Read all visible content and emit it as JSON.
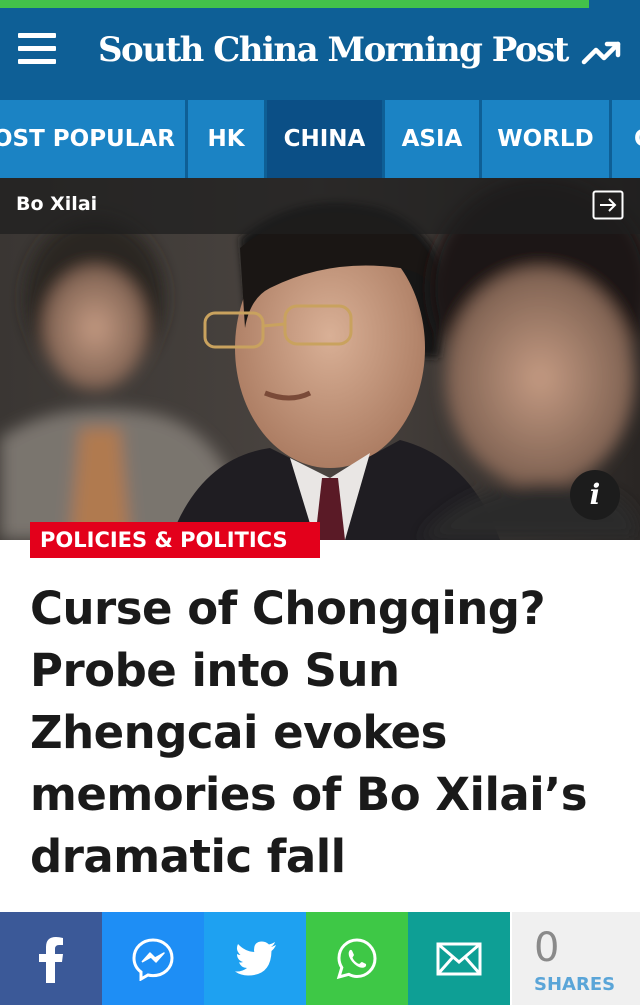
{
  "header": {
    "logo": "South China Morning Post",
    "read_progress": 0.92,
    "colors": {
      "header_bg": "#0e5f96",
      "progress": "#43c14a"
    }
  },
  "nav": {
    "tabs": [
      {
        "label": "MOST POPULAR",
        "active": false
      },
      {
        "label": "HK",
        "active": false
      },
      {
        "label": "CHINA",
        "active": true
      },
      {
        "label": "ASIA",
        "active": false
      },
      {
        "label": "WORLD",
        "active": false
      },
      {
        "label": "C",
        "active": false
      }
    ],
    "colors": {
      "tab_bg": "#1b83c4",
      "active_bg": "#0b4f86"
    }
  },
  "hero": {
    "topic": "Bo Xilai",
    "topic_icon": "arrow-right-boxed-icon",
    "info_icon": "info-icon",
    "info_glyph": "i"
  },
  "article": {
    "section": "POLICIES & POLITICS",
    "headline": "Curse of Chongqing? Probe into Sun Zhengcai evokes memories of Bo Xilai’s dramatic fall",
    "section_color": "#e3001b"
  },
  "share": {
    "buttons": [
      {
        "name": "facebook",
        "icon": "facebook-icon",
        "color": "#3b5998"
      },
      {
        "name": "messenger",
        "icon": "messenger-icon",
        "color": "#1e8ef5"
      },
      {
        "name": "twitter",
        "icon": "twitter-icon",
        "color": "#1ea1f1"
      },
      {
        "name": "whatsapp",
        "icon": "whatsapp-icon",
        "color": "#3ec846"
      },
      {
        "name": "email",
        "icon": "email-icon",
        "color": "#0e9f95"
      }
    ],
    "count": "0",
    "count_label": "SHARES"
  }
}
